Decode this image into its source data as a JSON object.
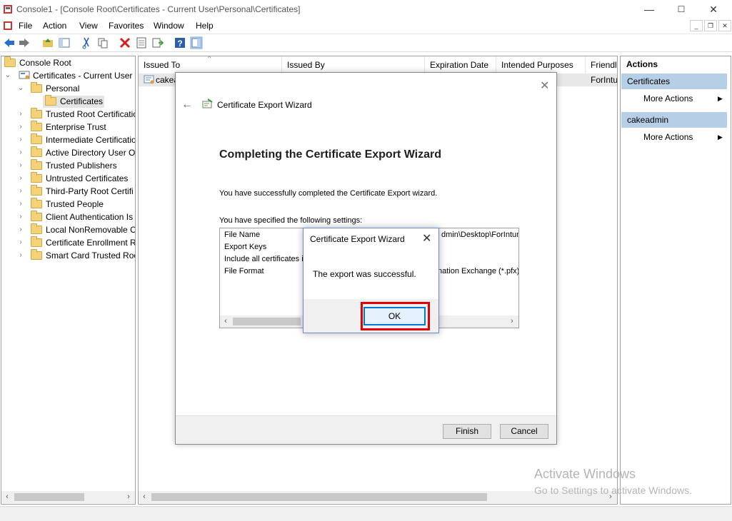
{
  "window": {
    "title": "Console1 - [Console Root\\Certificates - Current User\\Personal\\Certificates]",
    "controls": {
      "minimize": "—",
      "maximize": "☐",
      "close": "✕"
    }
  },
  "menu": {
    "items": [
      "File",
      "Action",
      "View",
      "Favorites",
      "Window",
      "Help"
    ],
    "mdi_controls": {
      "minimize": "_",
      "restore": "❐",
      "close": "✕"
    }
  },
  "tree": {
    "root": "Console Root",
    "store": "Certificates - Current User",
    "personal": "Personal",
    "selected": "Certificates",
    "items": [
      "Trusted Root Certificatio",
      "Enterprise Trust",
      "Intermediate Certificatio",
      "Active Directory User Ol",
      "Trusted Publishers",
      "Untrusted Certificates",
      "Third-Party Root Certifi",
      "Trusted People",
      "Client Authentication Is",
      "Local NonRemovable C",
      "Certificate Enrollment R",
      "Smart Card Trusted Roo"
    ]
  },
  "list": {
    "columns": [
      "Issued To",
      "Issued By",
      "Expiration Date",
      "Intended Purposes",
      "Friendl"
    ],
    "rows": [
      {
        "issued_to": "cakea",
        "friendly": "ForIntu"
      }
    ]
  },
  "actions": {
    "header": "Actions",
    "sections": [
      {
        "title": "Certificates",
        "item": "More Actions"
      },
      {
        "title": "cakeadmin",
        "item": "More Actions"
      }
    ]
  },
  "wizard": {
    "window_title": "Certificate Export Wizard",
    "heading": "Completing the Certificate Export Wizard",
    "success_msg": "You have successfully completed the Certificate Export wizard.",
    "settings_label": "You have specified the following settings:",
    "settings": [
      {
        "name": "File Name",
        "value": "dmin\\Desktop\\ForIntun"
      },
      {
        "name": "Export Keys",
        "value": ""
      },
      {
        "name": "Include all certificates i",
        "value": ""
      },
      {
        "name": "File Format",
        "value": "nation Exchange (*.pfx)"
      }
    ],
    "finish_label": "Finish",
    "cancel_label": "Cancel"
  },
  "msgbox": {
    "title": "Certificate Export Wizard",
    "text": "The export was successful.",
    "ok_label": "OK"
  },
  "watermark": {
    "line1": "Activate Windows",
    "line2": "Go to Settings to activate Windows."
  },
  "colors": {
    "highlight": "#e00000",
    "section_bg": "#b7cfe6",
    "ok_border": "#0078d7"
  }
}
